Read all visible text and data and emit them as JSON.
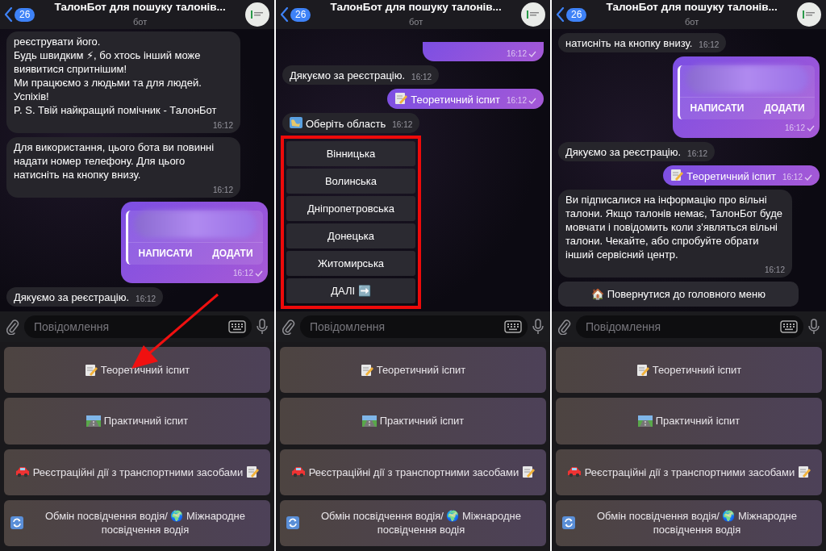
{
  "panels": [
    {
      "header": {
        "back_count": "26",
        "title": "ТалонБот для пошуку талонів...",
        "subtitle": "бот"
      },
      "messages": [
        {
          "kind": "text",
          "outgoing": false,
          "text": "реєструвати його.\nБудь швидким ⚡, бо хтось інший може виявитися спритнішим!\nМи працюємо з людьми та для людей.\nУспіхів!\nP. S. Твій найкращий помічник - ТалонБот",
          "time": "16:12"
        },
        {
          "kind": "text",
          "outgoing": false,
          "text": "Для використання, цього бота ви повинні надати номер телефону. Для цього натисніть на кнопку внизу.",
          "time": "16:12"
        },
        {
          "kind": "contact",
          "outgoing": true,
          "actions": [
            "НАПИСАТИ",
            "ДОДАТИ"
          ],
          "time": "16:12"
        },
        {
          "kind": "text",
          "outgoing": false,
          "text": "Дякуємо за реєстрацію.",
          "time": "16:12"
        }
      ],
      "input_placeholder": "Повідомлення",
      "pointer_arrow": true,
      "keyboard": [
        "Теоретичний іспит",
        "Практичний іспит",
        "Реєстраційні дії з транспортними засобами",
        "Обмін посвідчення водія/ 🌍 Міжнародне посвідчення водія"
      ]
    },
    {
      "header": {
        "back_count": "26",
        "title": "ТалонБот для пошуку талонів...",
        "subtitle": "бот"
      },
      "messages": [
        {
          "kind": "tail",
          "outgoing": true,
          "time": "16:12"
        },
        {
          "kind": "text",
          "outgoing": false,
          "text": "Дякуємо за реєстрацію.",
          "time": "16:12"
        },
        {
          "kind": "exam_choice",
          "outgoing": true,
          "text": "Теоретичний іспит",
          "time": "16:12"
        },
        {
          "kind": "region_prompt",
          "outgoing": false,
          "text": "Оберіть область",
          "time": "16:12"
        },
        {
          "kind": "buttons",
          "highlighted": true,
          "buttons": [
            "Вінницька",
            "Волинська",
            "Дніпропетровська",
            "Донецька",
            "Житомирська",
            "ДАЛІ ➡️"
          ]
        }
      ],
      "input_placeholder": "Повідомлення",
      "pointer_arrow": false,
      "keyboard": [
        "Теоретичний іспит",
        "Практичний іспит",
        "Реєстраційні дії з транспортними засобами",
        "Обмін посвідчення водія/ 🌍 Міжнародне посвідчення водія"
      ]
    },
    {
      "header": {
        "back_count": "26",
        "title": "ТалонБот для пошуку талонів...",
        "subtitle": "бот"
      },
      "messages": [
        {
          "kind": "text",
          "outgoing": false,
          "text": "натисніть на кнопку внизу.",
          "time": "16:12"
        },
        {
          "kind": "contact",
          "outgoing": true,
          "actions": [
            "НАПИСАТИ",
            "ДОДАТИ"
          ],
          "time": "16:12"
        },
        {
          "kind": "text",
          "outgoing": false,
          "text": "Дякуємо за реєстрацію.",
          "time": "16:12"
        },
        {
          "kind": "exam_choice",
          "outgoing": true,
          "text": "Теоретичний іспит",
          "time": "16:12"
        },
        {
          "kind": "text",
          "outgoing": false,
          "text": "Ви підписалися на інформацію про вільні талони. Якщо талонів немає, ТалонБот буде мовчати і повідомить коли з'являться вільні талони. Чекайте, або спробуйте обрати інший сервісний центр.",
          "time": "16:12"
        },
        {
          "kind": "buttons",
          "highlighted": false,
          "buttons": [
            "🏠 Повернутися до головного меню"
          ]
        }
      ],
      "input_placeholder": "Повідомлення",
      "pointer_arrow": false,
      "keyboard": [
        "Теоретичний іспит",
        "Практичний іспит",
        "Реєстраційні дії з транспортними засобами",
        "Обмін посвідчення водія/ 🌍 Міжнародне посвідчення водія"
      ]
    }
  ]
}
